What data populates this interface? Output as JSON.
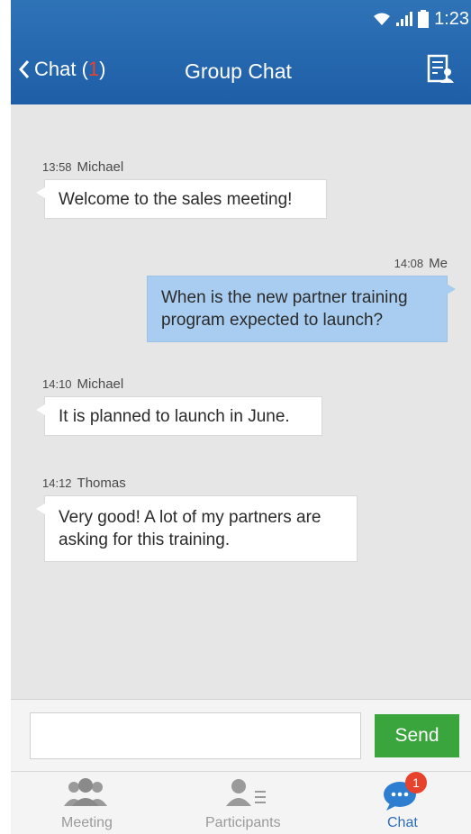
{
  "status": {
    "time": "1:23"
  },
  "nav": {
    "back_label": "Chat (",
    "back_count": "1",
    "back_close": ")",
    "title": "Group Chat"
  },
  "messages": [
    {
      "time": "13:58",
      "sender": "Michael",
      "text": "Welcome to the sales meeting!",
      "direction": "incoming"
    },
    {
      "time": "14:08",
      "sender": "Me",
      "text": "When is the new partner training program expected to launch?",
      "direction": "outgoing"
    },
    {
      "time": "14:10",
      "sender": "Michael",
      "text": "It is planned to launch in June.",
      "direction": "incoming"
    },
    {
      "time": "14:12",
      "sender": "Thomas",
      "text": "Very good! A lot of my partners are asking for this training.",
      "direction": "incoming"
    }
  ],
  "input": {
    "value": "",
    "placeholder": "",
    "send_label": "Send"
  },
  "tabs": [
    {
      "label": "Meeting",
      "icon": "meeting-icon",
      "active": false
    },
    {
      "label": "Participants",
      "icon": "participants-icon",
      "active": false
    },
    {
      "label": "Chat",
      "icon": "chat-icon",
      "active": true,
      "badge": "1"
    }
  ],
  "colors": {
    "header": "#1e5ea7",
    "background": "#e6e6e6",
    "outgoing_bubble": "#a8cdf0",
    "send_button": "#3aa53d",
    "badge": "#e8412c",
    "active_tab": "#2d6eb6"
  }
}
